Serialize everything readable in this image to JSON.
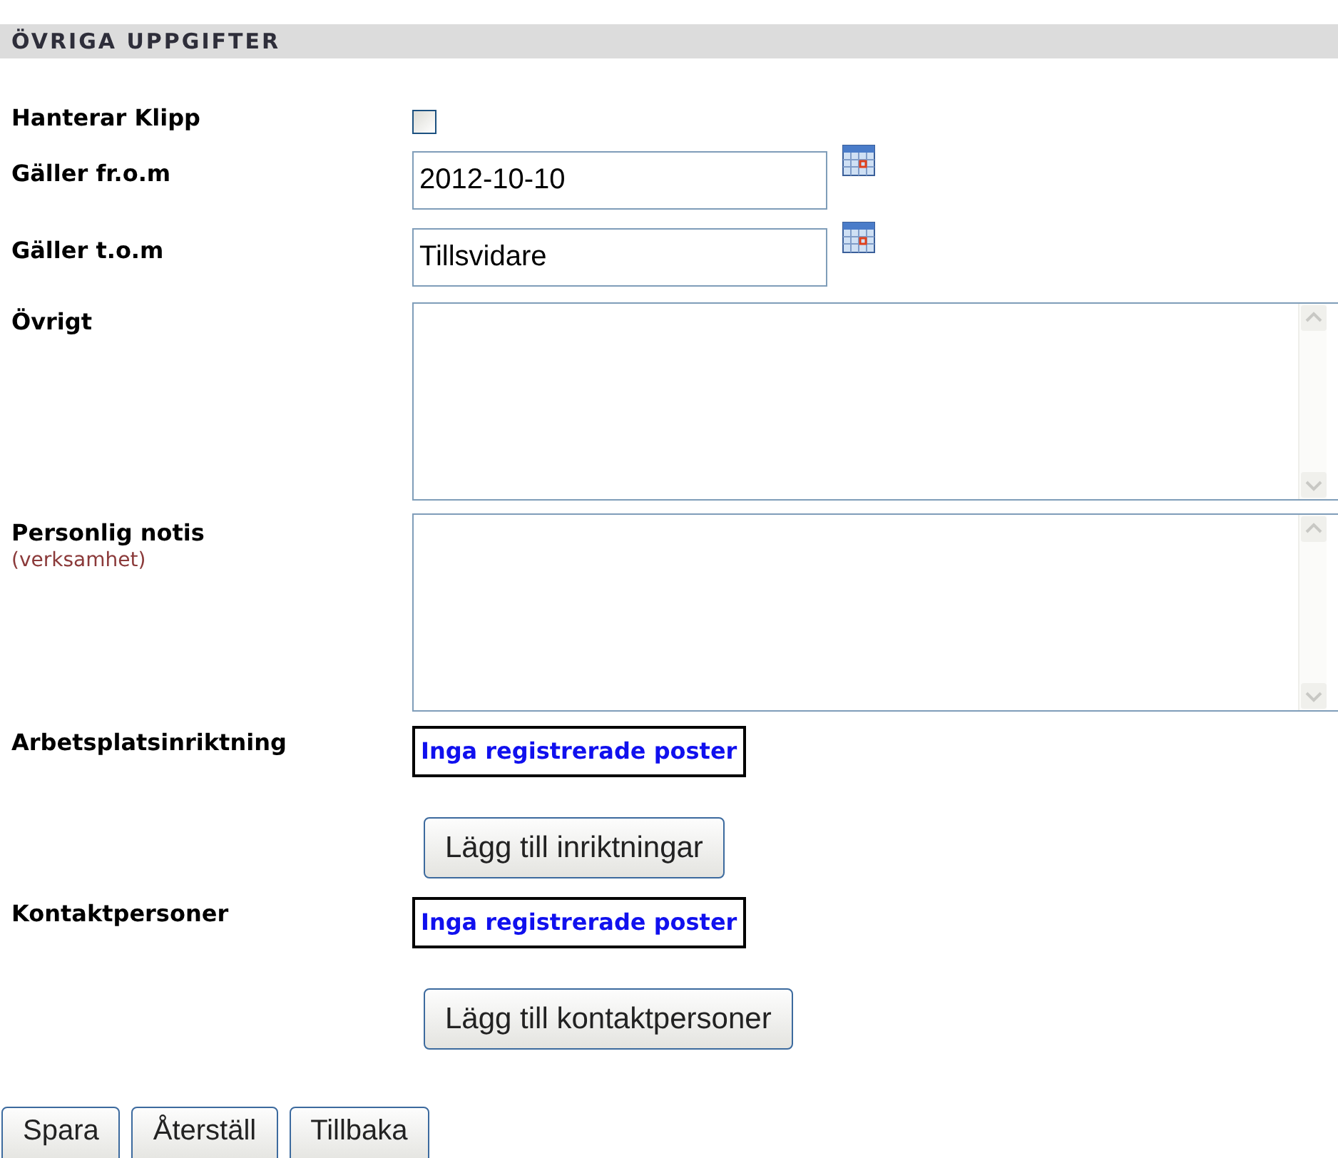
{
  "section_title": "ÖVRIGA UPPGIFTER",
  "fields": [
    {
      "kind": "checkbox",
      "label": "Hanterar Klipp",
      "checked": false
    },
    {
      "kind": "date",
      "label": "Gäller fr.o.m",
      "value": "2012-10-10"
    },
    {
      "kind": "date",
      "label": "Gäller t.o.m",
      "value": "Tillsvidare"
    },
    {
      "kind": "textarea",
      "label": "Övrigt"
    },
    {
      "kind": "textarea",
      "label": "Personlig notis",
      "note": "(verksamhet)"
    },
    {
      "kind": "list",
      "label": "Arbetsplatsinriktning",
      "empty_text": "Inga registrerade poster",
      "button": "Lägg till inriktningar"
    },
    {
      "kind": "list",
      "label": "Kontaktpersoner",
      "empty_text": "Inga registrerade poster",
      "button": "Lägg till kontaktpersoner"
    }
  ],
  "buttons": [
    "Spara",
    "Återställ",
    "Tillbaka"
  ]
}
